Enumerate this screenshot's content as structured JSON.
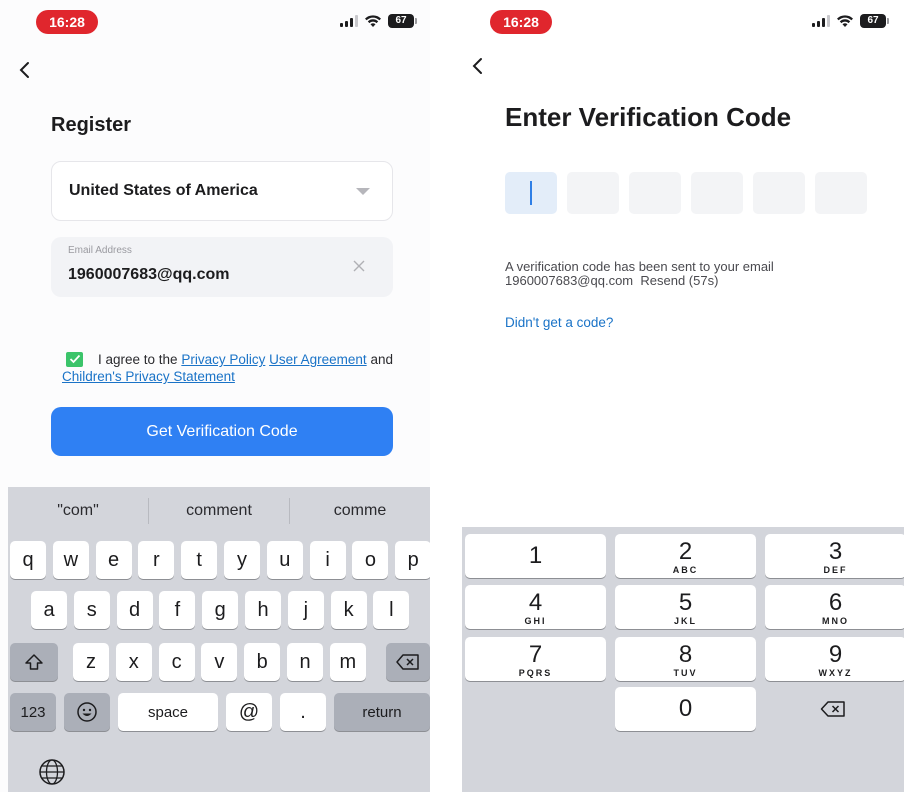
{
  "left_screen": {
    "status_bar": {
      "time": "16:28",
      "battery": "67"
    },
    "title": "Register",
    "country_select": {
      "value": "United States of America"
    },
    "email_field": {
      "label": "Email Address",
      "value": "1960007683@qq.com"
    },
    "agreement": {
      "prefix": "I agree to the",
      "privacy_policy": "Privacy Policy",
      "user_agreement": "User Agreement",
      "and": "and",
      "childrens_privacy": "Children's Privacy Statement"
    },
    "primary_button": "Get Verification Code",
    "keyboard": {
      "suggestions": [
        "\"com\"",
        "comment",
        "comme"
      ],
      "row1": [
        "q",
        "w",
        "e",
        "r",
        "t",
        "y",
        "u",
        "i",
        "o",
        "p"
      ],
      "row2": [
        "a",
        "s",
        "d",
        "f",
        "g",
        "h",
        "j",
        "k",
        "l"
      ],
      "row3": [
        "z",
        "x",
        "c",
        "v",
        "b",
        "n",
        "m"
      ],
      "numbers_key": "123",
      "space_key": "space",
      "at_key": "@",
      "dot_key": ".",
      "return_key": "return"
    }
  },
  "right_screen": {
    "status_bar": {
      "time": "16:28",
      "battery": "67"
    },
    "title": "Enter Verification Code",
    "code_length": 6,
    "sent_message": "A verification code has been sent to your email",
    "sent_email": "1960007683@qq.com",
    "resend": "Resend (57s)",
    "no_code_link": "Didn't get a code?",
    "keypad": [
      {
        "digit": "1",
        "letters": ""
      },
      {
        "digit": "2",
        "letters": "ABC"
      },
      {
        "digit": "3",
        "letters": "DEF"
      },
      {
        "digit": "4",
        "letters": "GHI"
      },
      {
        "digit": "5",
        "letters": "JKL"
      },
      {
        "digit": "6",
        "letters": "MNO"
      },
      {
        "digit": "7",
        "letters": "PQRS"
      },
      {
        "digit": "8",
        "letters": "TUV"
      },
      {
        "digit": "9",
        "letters": "WXYZ"
      },
      {
        "digit": "0",
        "letters": ""
      }
    ]
  },
  "colors": {
    "primary_button": "#2f80f3",
    "link": "#1a73c7",
    "checkbox": "#3bc46a",
    "time_pill": "#e0262d"
  }
}
